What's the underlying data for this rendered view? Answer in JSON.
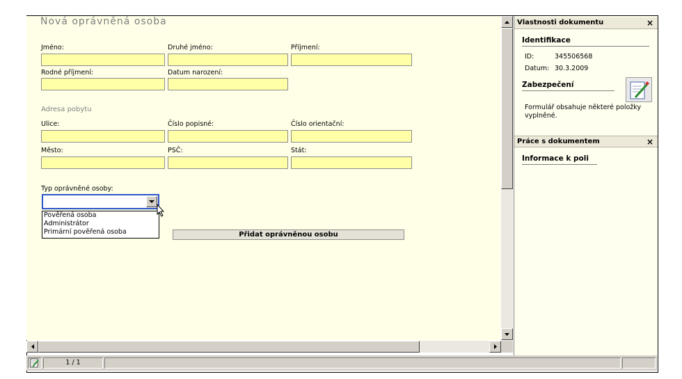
{
  "form": {
    "title": "Nová oprávněná osoba",
    "labels": {
      "first_name": "Jméno:",
      "middle_name": "Druhé jméno:",
      "last_name": "Příjmení:",
      "birth_surname": "Rodné příjmení:",
      "birth_date": "Datum narození:",
      "street": "Ulice:",
      "house_number": "Číslo popisné:",
      "orientation_number": "Číslo orientační:",
      "city": "Město:",
      "zip": "PSČ:",
      "country": "Stát:",
      "person_type": "Typ oprávněné osoby:"
    },
    "address_section": "Adresa pobytu",
    "person_type": {
      "selected": "",
      "options": [
        "Pověřená osoba",
        "Administrátor",
        "Primární pověřená osoba"
      ]
    },
    "add_button": "Přidat oprávněnou osobu",
    "colors": {
      "field_bg": "#ffffa8",
      "doc_bg": "#ffffe8",
      "focus_border": "#2a55c8"
    }
  },
  "status_bar": {
    "page_indicator": "1 / 1"
  },
  "properties_panel": {
    "title": "Vlastnosti dokumentu",
    "identification": {
      "heading": "Identifikace",
      "id_label": "ID:",
      "id_value": "345506568",
      "date_label": "Datum:",
      "date_value": "30.3.2009"
    },
    "security": {
      "heading": "Zabezpečení",
      "text": "Formulář obsahuje některé položky vyplněné."
    }
  },
  "work_panel": {
    "title": "Práce s dokumentem",
    "field_info_heading": "Informace k poli"
  },
  "icons": {
    "close": "close-icon",
    "edit": "edit-document-icon",
    "scroll_up": "arrow-up-icon",
    "scroll_down": "arrow-down-icon",
    "scroll_left": "arrow-left-icon",
    "scroll_right": "arrow-right-icon",
    "dropdown": "chevron-down-icon"
  }
}
